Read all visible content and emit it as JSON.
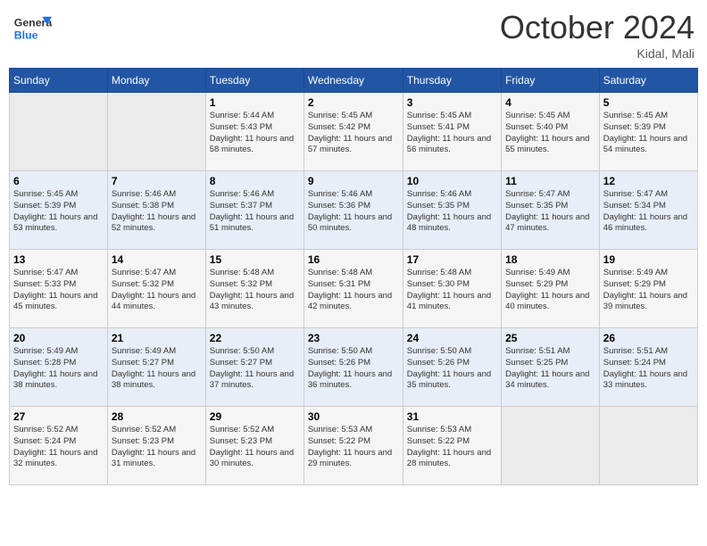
{
  "header": {
    "logo_line1": "General",
    "logo_line2": "Blue",
    "month": "October 2024",
    "location": "Kidal, Mali"
  },
  "weekdays": [
    "Sunday",
    "Monday",
    "Tuesday",
    "Wednesday",
    "Thursday",
    "Friday",
    "Saturday"
  ],
  "weeks": [
    [
      {
        "day": "",
        "sunrise": "",
        "sunset": "",
        "daylight": ""
      },
      {
        "day": "",
        "sunrise": "",
        "sunset": "",
        "daylight": ""
      },
      {
        "day": "1",
        "sunrise": "Sunrise: 5:44 AM",
        "sunset": "Sunset: 5:43 PM",
        "daylight": "Daylight: 11 hours and 58 minutes."
      },
      {
        "day": "2",
        "sunrise": "Sunrise: 5:45 AM",
        "sunset": "Sunset: 5:42 PM",
        "daylight": "Daylight: 11 hours and 57 minutes."
      },
      {
        "day": "3",
        "sunrise": "Sunrise: 5:45 AM",
        "sunset": "Sunset: 5:41 PM",
        "daylight": "Daylight: 11 hours and 56 minutes."
      },
      {
        "day": "4",
        "sunrise": "Sunrise: 5:45 AM",
        "sunset": "Sunset: 5:40 PM",
        "daylight": "Daylight: 11 hours and 55 minutes."
      },
      {
        "day": "5",
        "sunrise": "Sunrise: 5:45 AM",
        "sunset": "Sunset: 5:39 PM",
        "daylight": "Daylight: 11 hours and 54 minutes."
      }
    ],
    [
      {
        "day": "6",
        "sunrise": "Sunrise: 5:45 AM",
        "sunset": "Sunset: 5:39 PM",
        "daylight": "Daylight: 11 hours and 53 minutes."
      },
      {
        "day": "7",
        "sunrise": "Sunrise: 5:46 AM",
        "sunset": "Sunset: 5:38 PM",
        "daylight": "Daylight: 11 hours and 52 minutes."
      },
      {
        "day": "8",
        "sunrise": "Sunrise: 5:46 AM",
        "sunset": "Sunset: 5:37 PM",
        "daylight": "Daylight: 11 hours and 51 minutes."
      },
      {
        "day": "9",
        "sunrise": "Sunrise: 5:46 AM",
        "sunset": "Sunset: 5:36 PM",
        "daylight": "Daylight: 11 hours and 50 minutes."
      },
      {
        "day": "10",
        "sunrise": "Sunrise: 5:46 AM",
        "sunset": "Sunset: 5:35 PM",
        "daylight": "Daylight: 11 hours and 48 minutes."
      },
      {
        "day": "11",
        "sunrise": "Sunrise: 5:47 AM",
        "sunset": "Sunset: 5:35 PM",
        "daylight": "Daylight: 11 hours and 47 minutes."
      },
      {
        "day": "12",
        "sunrise": "Sunrise: 5:47 AM",
        "sunset": "Sunset: 5:34 PM",
        "daylight": "Daylight: 11 hours and 46 minutes."
      }
    ],
    [
      {
        "day": "13",
        "sunrise": "Sunrise: 5:47 AM",
        "sunset": "Sunset: 5:33 PM",
        "daylight": "Daylight: 11 hours and 45 minutes."
      },
      {
        "day": "14",
        "sunrise": "Sunrise: 5:47 AM",
        "sunset": "Sunset: 5:32 PM",
        "daylight": "Daylight: 11 hours and 44 minutes."
      },
      {
        "day": "15",
        "sunrise": "Sunrise: 5:48 AM",
        "sunset": "Sunset: 5:32 PM",
        "daylight": "Daylight: 11 hours and 43 minutes."
      },
      {
        "day": "16",
        "sunrise": "Sunrise: 5:48 AM",
        "sunset": "Sunset: 5:31 PM",
        "daylight": "Daylight: 11 hours and 42 minutes."
      },
      {
        "day": "17",
        "sunrise": "Sunrise: 5:48 AM",
        "sunset": "Sunset: 5:30 PM",
        "daylight": "Daylight: 11 hours and 41 minutes."
      },
      {
        "day": "18",
        "sunrise": "Sunrise: 5:49 AM",
        "sunset": "Sunset: 5:29 PM",
        "daylight": "Daylight: 11 hours and 40 minutes."
      },
      {
        "day": "19",
        "sunrise": "Sunrise: 5:49 AM",
        "sunset": "Sunset: 5:29 PM",
        "daylight": "Daylight: 11 hours and 39 minutes."
      }
    ],
    [
      {
        "day": "20",
        "sunrise": "Sunrise: 5:49 AM",
        "sunset": "Sunset: 5:28 PM",
        "daylight": "Daylight: 11 hours and 38 minutes."
      },
      {
        "day": "21",
        "sunrise": "Sunrise: 5:49 AM",
        "sunset": "Sunset: 5:27 PM",
        "daylight": "Daylight: 11 hours and 38 minutes."
      },
      {
        "day": "22",
        "sunrise": "Sunrise: 5:50 AM",
        "sunset": "Sunset: 5:27 PM",
        "daylight": "Daylight: 11 hours and 37 minutes."
      },
      {
        "day": "23",
        "sunrise": "Sunrise: 5:50 AM",
        "sunset": "Sunset: 5:26 PM",
        "daylight": "Daylight: 11 hours and 36 minutes."
      },
      {
        "day": "24",
        "sunrise": "Sunrise: 5:50 AM",
        "sunset": "Sunset: 5:26 PM",
        "daylight": "Daylight: 11 hours and 35 minutes."
      },
      {
        "day": "25",
        "sunrise": "Sunrise: 5:51 AM",
        "sunset": "Sunset: 5:25 PM",
        "daylight": "Daylight: 11 hours and 34 minutes."
      },
      {
        "day": "26",
        "sunrise": "Sunrise: 5:51 AM",
        "sunset": "Sunset: 5:24 PM",
        "daylight": "Daylight: 11 hours and 33 minutes."
      }
    ],
    [
      {
        "day": "27",
        "sunrise": "Sunrise: 5:52 AM",
        "sunset": "Sunset: 5:24 PM",
        "daylight": "Daylight: 11 hours and 32 minutes."
      },
      {
        "day": "28",
        "sunrise": "Sunrise: 5:52 AM",
        "sunset": "Sunset: 5:23 PM",
        "daylight": "Daylight: 11 hours and 31 minutes."
      },
      {
        "day": "29",
        "sunrise": "Sunrise: 5:52 AM",
        "sunset": "Sunset: 5:23 PM",
        "daylight": "Daylight: 11 hours and 30 minutes."
      },
      {
        "day": "30",
        "sunrise": "Sunrise: 5:53 AM",
        "sunset": "Sunset: 5:22 PM",
        "daylight": "Daylight: 11 hours and 29 minutes."
      },
      {
        "day": "31",
        "sunrise": "Sunrise: 5:53 AM",
        "sunset": "Sunset: 5:22 PM",
        "daylight": "Daylight: 11 hours and 28 minutes."
      },
      {
        "day": "",
        "sunrise": "",
        "sunset": "",
        "daylight": ""
      },
      {
        "day": "",
        "sunrise": "",
        "sunset": "",
        "daylight": ""
      }
    ]
  ]
}
